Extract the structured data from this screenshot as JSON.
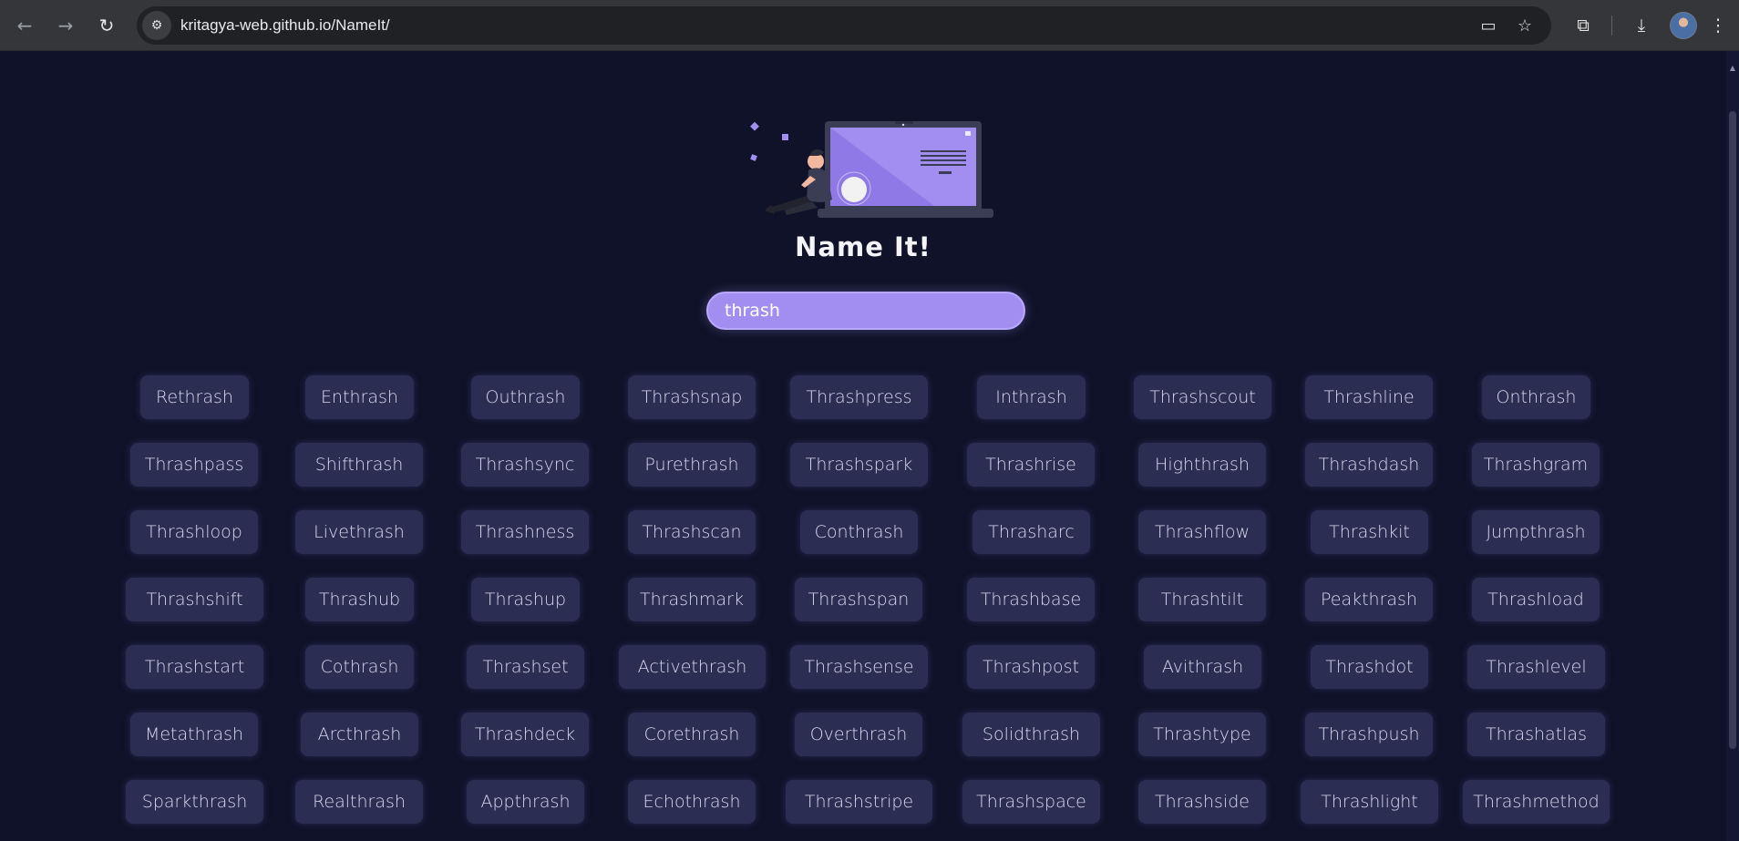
{
  "browser": {
    "url": "kritagya-web.github.io/NameIt/",
    "back_icon": "←",
    "forward_icon": "→",
    "reload_icon": "↻",
    "site_info_icon": "⚙",
    "install_icon": "▭",
    "bookmark_icon": "☆",
    "extensions_icon": "⧉",
    "downloads_icon": "⤓",
    "menu_icon": "⋮"
  },
  "page": {
    "title": "Name It!",
    "search_value": "thrash"
  },
  "results": [
    [
      "Rethrash",
      "Enthrash",
      "Outhrash",
      "Thrashsnap",
      "Thrashpress",
      "Inthrash",
      "Thrashscout",
      "Thrashline",
      "Onthrash"
    ],
    [
      "Thrashpass",
      "Shifthrash",
      "Thrashsync",
      "Purethrash",
      "Thrashspark",
      "Thrashrise",
      "Highthrash",
      "Thrashdash",
      "Thrashgram"
    ],
    [
      "Thrashloop",
      "Livethrash",
      "Thrashness",
      "Thrashscan",
      "Conthrash",
      "Thrasharc",
      "Thrashflow",
      "Thrashkit",
      "Jumpthrash"
    ],
    [
      "Thrashshift",
      "Thrashub",
      "Thrashup",
      "Thrashmark",
      "Thrashspan",
      "Thrashbase",
      "Thrashtilt",
      "Peakthrash",
      "Thrashload"
    ],
    [
      "Thrashstart",
      "Cothrash",
      "Thrashset",
      "Activethrash",
      "Thrashsense",
      "Thrashpost",
      "Avithrash",
      "Thrashdot",
      "Thrashlevel"
    ],
    [
      "Metathrash",
      "Arcthrash",
      "Thrashdeck",
      "Corethrash",
      "Overthrash",
      "Solidthrash",
      "Thrashtype",
      "Thrashpush",
      "Thrashatlas"
    ],
    [
      "Sparkthrash",
      "Realthrash",
      "Appthrash",
      "Echothrash",
      "Thrashstripe",
      "Thrashspace",
      "Thrashside",
      "Thrashlight",
      "Thrashmethod"
    ]
  ]
}
